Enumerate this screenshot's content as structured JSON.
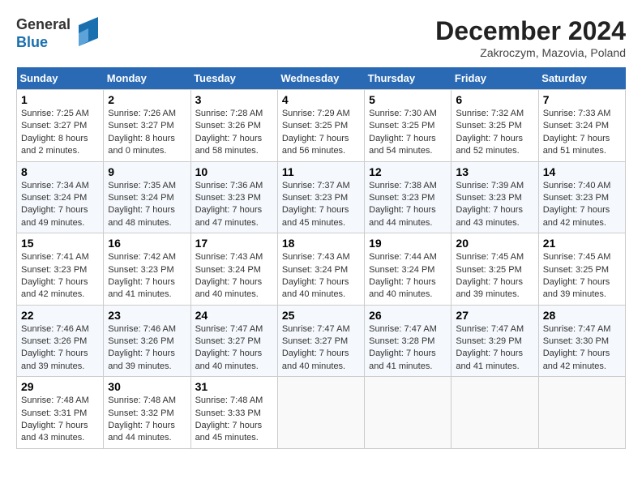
{
  "header": {
    "logo_line1": "General",
    "logo_line2": "Blue",
    "month_year": "December 2024",
    "location": "Zakroczym, Mazovia, Poland"
  },
  "weekdays": [
    "Sunday",
    "Monday",
    "Tuesday",
    "Wednesday",
    "Thursday",
    "Friday",
    "Saturday"
  ],
  "weeks": [
    [
      {
        "day": "1",
        "sunrise": "Sunrise: 7:25 AM",
        "sunset": "Sunset: 3:27 PM",
        "daylight": "Daylight: 8 hours and 2 minutes."
      },
      {
        "day": "2",
        "sunrise": "Sunrise: 7:26 AM",
        "sunset": "Sunset: 3:27 PM",
        "daylight": "Daylight: 8 hours and 0 minutes."
      },
      {
        "day": "3",
        "sunrise": "Sunrise: 7:28 AM",
        "sunset": "Sunset: 3:26 PM",
        "daylight": "Daylight: 7 hours and 58 minutes."
      },
      {
        "day": "4",
        "sunrise": "Sunrise: 7:29 AM",
        "sunset": "Sunset: 3:25 PM",
        "daylight": "Daylight: 7 hours and 56 minutes."
      },
      {
        "day": "5",
        "sunrise": "Sunrise: 7:30 AM",
        "sunset": "Sunset: 3:25 PM",
        "daylight": "Daylight: 7 hours and 54 minutes."
      },
      {
        "day": "6",
        "sunrise": "Sunrise: 7:32 AM",
        "sunset": "Sunset: 3:25 PM",
        "daylight": "Daylight: 7 hours and 52 minutes."
      },
      {
        "day": "7",
        "sunrise": "Sunrise: 7:33 AM",
        "sunset": "Sunset: 3:24 PM",
        "daylight": "Daylight: 7 hours and 51 minutes."
      }
    ],
    [
      {
        "day": "8",
        "sunrise": "Sunrise: 7:34 AM",
        "sunset": "Sunset: 3:24 PM",
        "daylight": "Daylight: 7 hours and 49 minutes."
      },
      {
        "day": "9",
        "sunrise": "Sunrise: 7:35 AM",
        "sunset": "Sunset: 3:24 PM",
        "daylight": "Daylight: 7 hours and 48 minutes."
      },
      {
        "day": "10",
        "sunrise": "Sunrise: 7:36 AM",
        "sunset": "Sunset: 3:23 PM",
        "daylight": "Daylight: 7 hours and 47 minutes."
      },
      {
        "day": "11",
        "sunrise": "Sunrise: 7:37 AM",
        "sunset": "Sunset: 3:23 PM",
        "daylight": "Daylight: 7 hours and 45 minutes."
      },
      {
        "day": "12",
        "sunrise": "Sunrise: 7:38 AM",
        "sunset": "Sunset: 3:23 PM",
        "daylight": "Daylight: 7 hours and 44 minutes."
      },
      {
        "day": "13",
        "sunrise": "Sunrise: 7:39 AM",
        "sunset": "Sunset: 3:23 PM",
        "daylight": "Daylight: 7 hours and 43 minutes."
      },
      {
        "day": "14",
        "sunrise": "Sunrise: 7:40 AM",
        "sunset": "Sunset: 3:23 PM",
        "daylight": "Daylight: 7 hours and 42 minutes."
      }
    ],
    [
      {
        "day": "15",
        "sunrise": "Sunrise: 7:41 AM",
        "sunset": "Sunset: 3:23 PM",
        "daylight": "Daylight: 7 hours and 42 minutes."
      },
      {
        "day": "16",
        "sunrise": "Sunrise: 7:42 AM",
        "sunset": "Sunset: 3:23 PM",
        "daylight": "Daylight: 7 hours and 41 minutes."
      },
      {
        "day": "17",
        "sunrise": "Sunrise: 7:43 AM",
        "sunset": "Sunset: 3:24 PM",
        "daylight": "Daylight: 7 hours and 40 minutes."
      },
      {
        "day": "18",
        "sunrise": "Sunrise: 7:43 AM",
        "sunset": "Sunset: 3:24 PM",
        "daylight": "Daylight: 7 hours and 40 minutes."
      },
      {
        "day": "19",
        "sunrise": "Sunrise: 7:44 AM",
        "sunset": "Sunset: 3:24 PM",
        "daylight": "Daylight: 7 hours and 40 minutes."
      },
      {
        "day": "20",
        "sunrise": "Sunrise: 7:45 AM",
        "sunset": "Sunset: 3:25 PM",
        "daylight": "Daylight: 7 hours and 39 minutes."
      },
      {
        "day": "21",
        "sunrise": "Sunrise: 7:45 AM",
        "sunset": "Sunset: 3:25 PM",
        "daylight": "Daylight: 7 hours and 39 minutes."
      }
    ],
    [
      {
        "day": "22",
        "sunrise": "Sunrise: 7:46 AM",
        "sunset": "Sunset: 3:26 PM",
        "daylight": "Daylight: 7 hours and 39 minutes."
      },
      {
        "day": "23",
        "sunrise": "Sunrise: 7:46 AM",
        "sunset": "Sunset: 3:26 PM",
        "daylight": "Daylight: 7 hours and 39 minutes."
      },
      {
        "day": "24",
        "sunrise": "Sunrise: 7:47 AM",
        "sunset": "Sunset: 3:27 PM",
        "daylight": "Daylight: 7 hours and 40 minutes."
      },
      {
        "day": "25",
        "sunrise": "Sunrise: 7:47 AM",
        "sunset": "Sunset: 3:27 PM",
        "daylight": "Daylight: 7 hours and 40 minutes."
      },
      {
        "day": "26",
        "sunrise": "Sunrise: 7:47 AM",
        "sunset": "Sunset: 3:28 PM",
        "daylight": "Daylight: 7 hours and 41 minutes."
      },
      {
        "day": "27",
        "sunrise": "Sunrise: 7:47 AM",
        "sunset": "Sunset: 3:29 PM",
        "daylight": "Daylight: 7 hours and 41 minutes."
      },
      {
        "day": "28",
        "sunrise": "Sunrise: 7:47 AM",
        "sunset": "Sunset: 3:30 PM",
        "daylight": "Daylight: 7 hours and 42 minutes."
      }
    ],
    [
      {
        "day": "29",
        "sunrise": "Sunrise: 7:48 AM",
        "sunset": "Sunset: 3:31 PM",
        "daylight": "Daylight: 7 hours and 43 minutes."
      },
      {
        "day": "30",
        "sunrise": "Sunrise: 7:48 AM",
        "sunset": "Sunset: 3:32 PM",
        "daylight": "Daylight: 7 hours and 44 minutes."
      },
      {
        "day": "31",
        "sunrise": "Sunrise: 7:48 AM",
        "sunset": "Sunset: 3:33 PM",
        "daylight": "Daylight: 7 hours and 45 minutes."
      },
      null,
      null,
      null,
      null
    ]
  ]
}
